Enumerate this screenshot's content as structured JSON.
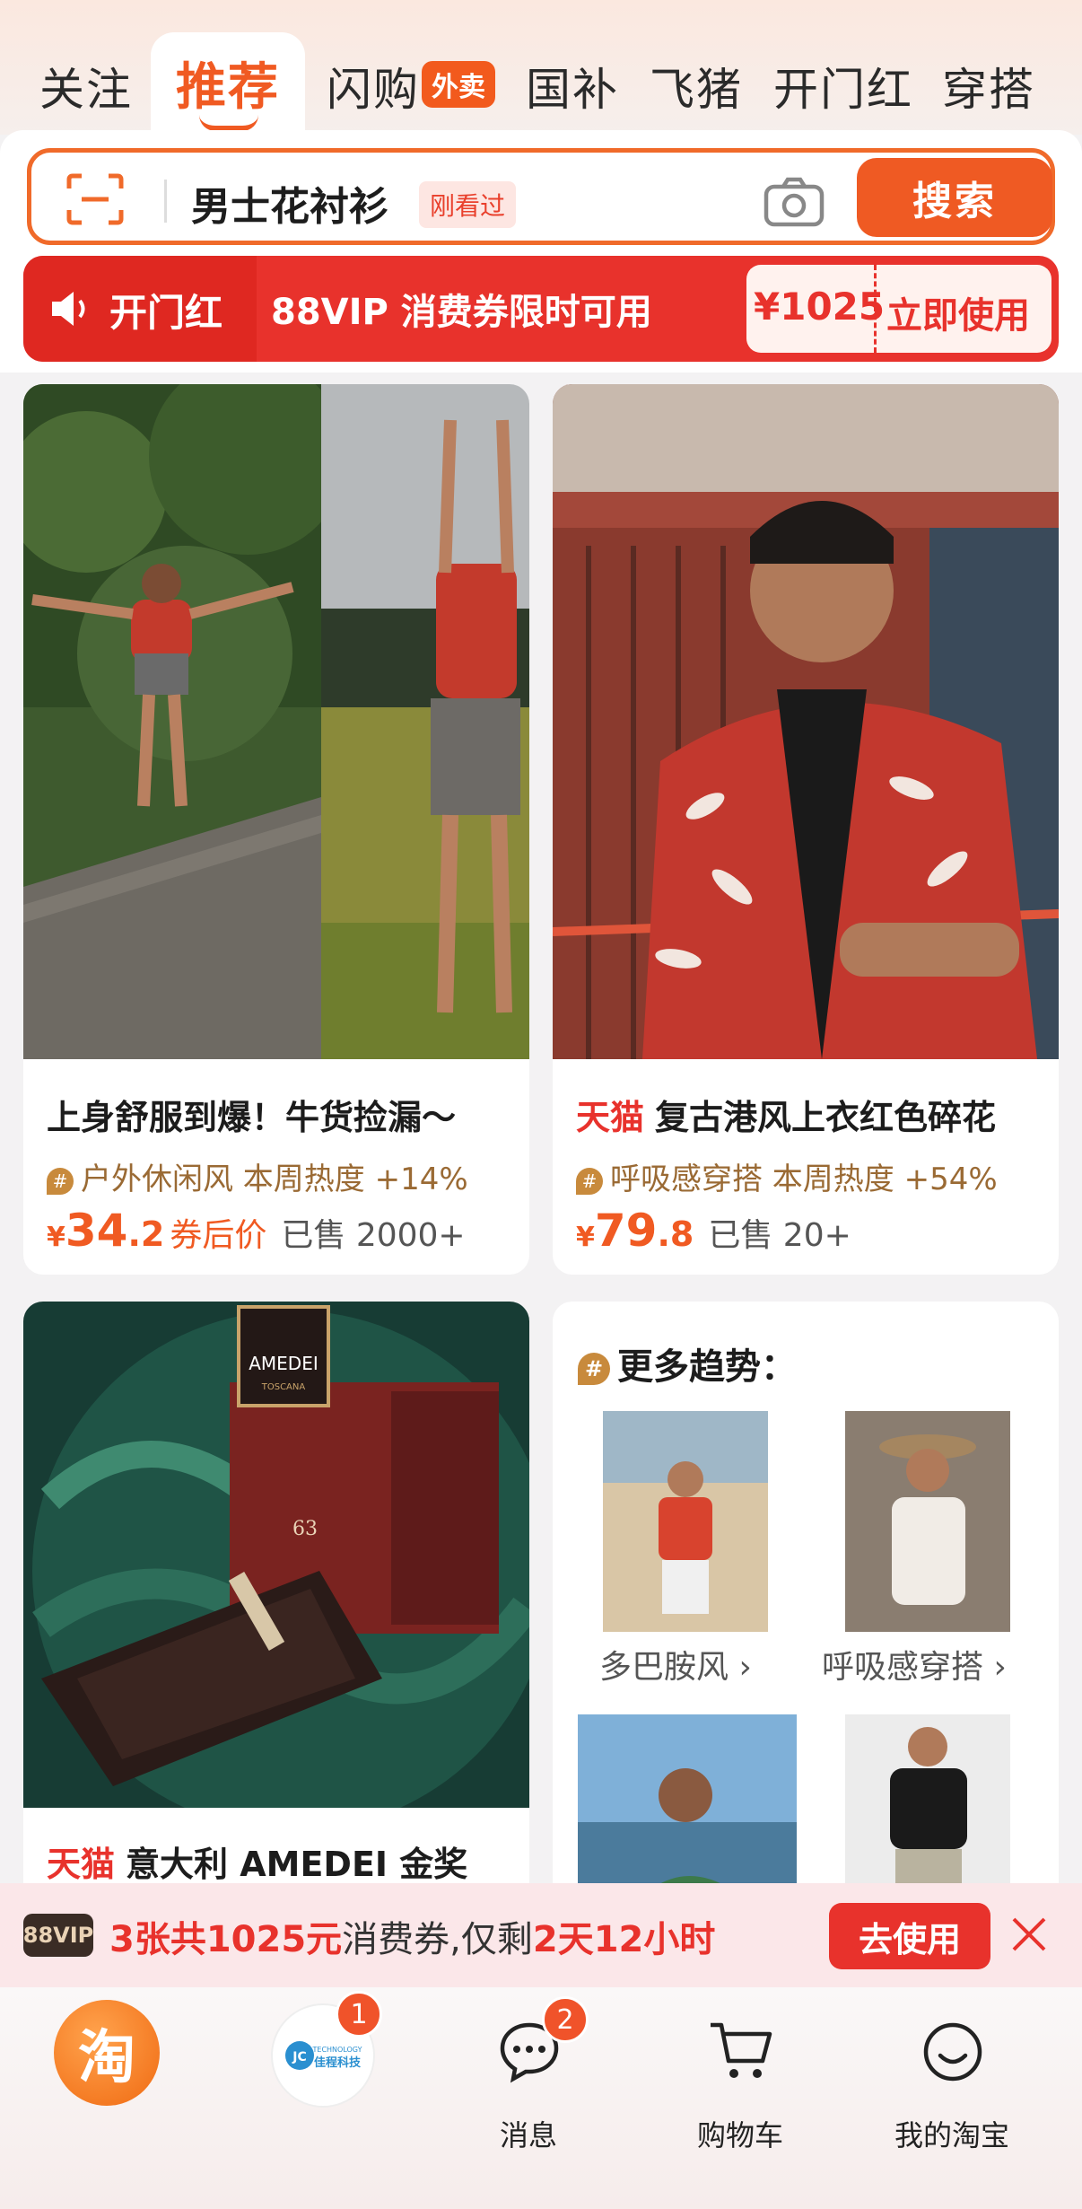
{
  "tabs": {
    "items": [
      "关注",
      "推荐",
      "闪购",
      "国补",
      "飞猪",
      "开门红",
      "穿搭"
    ],
    "active_index": 1,
    "waimai_badge": "外卖"
  },
  "search": {
    "query": "男士花衬衫",
    "recent_tag": "刚看过",
    "button": "搜索"
  },
  "promo": {
    "brand": "开门红",
    "text": "88VIP 消费券限时可用",
    "coupon_amount": "¥1025",
    "coupon_action": "立即使用"
  },
  "cards": {
    "card1": {
      "title": "上身舒服到爆！牛货捡漏～",
      "trend": "户外休闲风 本周热度 +14%",
      "yen": "¥",
      "price_int": "34",
      "price_dec": ".2",
      "price_note": "券后价",
      "sold": "已售 2000+"
    },
    "card2": {
      "tmall": "天猫",
      "title": "复古港风上衣红色碎花",
      "trend": "呼吸感穿搭 本周热度 +54%",
      "yen": "¥",
      "price_int": "79",
      "price_dec": ".8",
      "sold": "已售 20+"
    },
    "card3": {
      "tmall": "天猫",
      "title": "意大利 AMEDEI 金奖",
      "brand_label": "AMEDEI",
      "brand_sub": "TOSCANA",
      "box_number": "63"
    },
    "trends": {
      "title": "更多趋势：",
      "items": [
        "多巴胺风 ›",
        "呼吸感穿搭 ›"
      ]
    }
  },
  "notice": {
    "vip": "88VIP",
    "part1": "3张共1025元",
    "part2": "消费券,仅剩",
    "part3": "2天12小时",
    "button": "去使用"
  },
  "bottom_nav": {
    "home_glyph": "淘",
    "company_badge": "1",
    "company_name": "佳程科技",
    "company_tag": "TECHNOLOGY",
    "messages_badge": "2",
    "messages": "消息",
    "cart": "购物车",
    "mine": "我的淘宝"
  },
  "colors": {
    "accent": "#f05a22",
    "promo_red": "#e8322c",
    "trend_brown": "#9a6a34"
  }
}
